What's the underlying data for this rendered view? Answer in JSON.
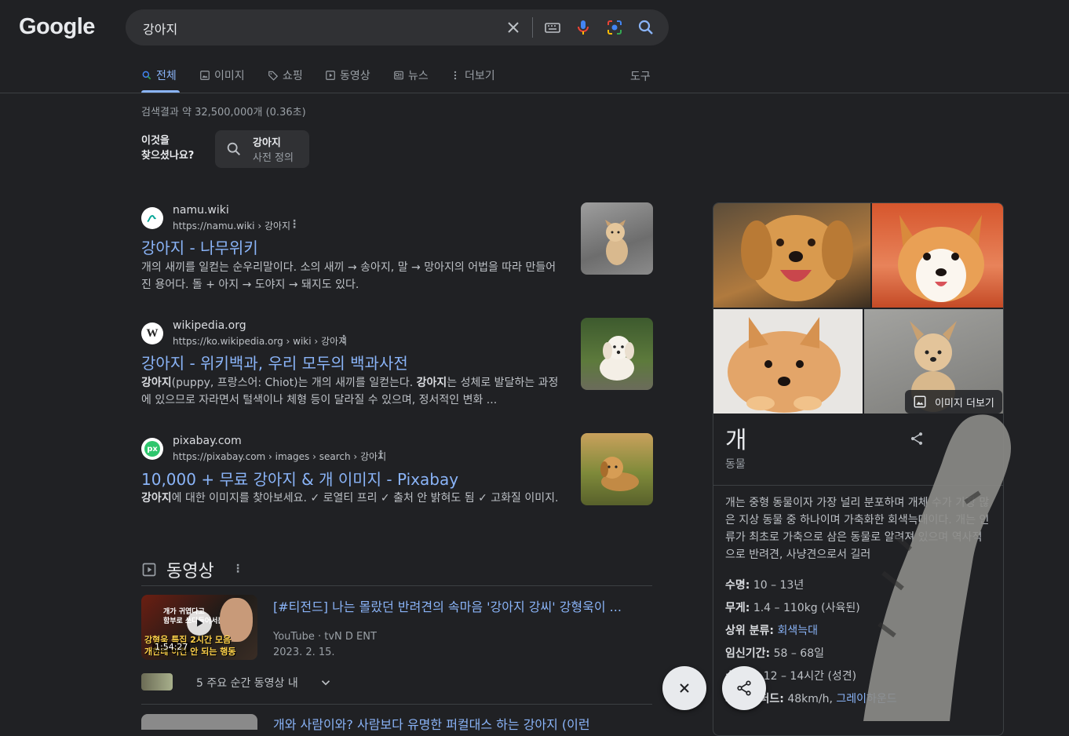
{
  "header": {
    "logo": "Google",
    "search_value": "강아지"
  },
  "tabs": [
    {
      "label": "전체",
      "icon": "search-icon",
      "active": true
    },
    {
      "label": "이미지",
      "icon": "image-icon"
    },
    {
      "label": "쇼핑",
      "icon": "tag-icon"
    },
    {
      "label": "동영상",
      "icon": "play-icon"
    },
    {
      "label": "뉴스",
      "icon": "news-icon"
    },
    {
      "label": "더보기",
      "icon": "more-vert-icon"
    }
  ],
  "tools_label": "도구",
  "result_stats": "검색결과 약 32,500,000개 (0.36초)",
  "did_you_mean": {
    "label": "이것을\n찾으셨나요?",
    "title": "강아지",
    "subtitle": "사전 정의"
  },
  "results": [
    {
      "site": "namu.wiki",
      "url": "https://namu.wiki › 강아지",
      "title": "강아지 - 나무위키",
      "snippet": "개의 새끼를 일컫는 순우리말이다. 소의 새끼 → 송아지, 말 → 망아지의 어법을 따라 만들어진 용어다. 돌 + 아지 → 도야지 → 돼지도 있다."
    },
    {
      "site": "wikipedia.org",
      "url": "https://ko.wikipedia.org › wiki › 강아지",
      "title": "강아지 - 위키백과, 우리 모두의 백과사전",
      "snippet_parts": [
        "강아지",
        "(puppy, 프랑스어: Chiot)는 개의 새끼를 일컫는다. ",
        "강아지",
        "는 성체로 발달하는 과정에 있으므로 자라면서 털색이나 체형 등이 달라질 수 있으며, 정서적인 변화 ..."
      ]
    },
    {
      "site": "pixabay.com",
      "url": "https://pixabay.com › images › search › 강아지",
      "title": "10,000 + 무료 강아지 & 개 이미지 - Pixabay",
      "snippet_parts": [
        "강아지",
        "에 대한 이미지를 찾아보세요. ✓ 로열티 프리 ✓ 출처 안 밝혀도 됨 ✓ 고화질 이미지."
      ]
    }
  ],
  "videos": {
    "heading": "동영상",
    "item": {
      "title": "[#티전드] 나는 몰랐던 반려견의 속마음 '강아지 강씨' 강형욱이 ...",
      "source": "YouTube · tvN D ENT",
      "date": "2023. 2. 15.",
      "duration": "1:54:27",
      "thumb_caption_top": "개가 귀엽다고\n함부로 쓰다듬어서는",
      "thumb_caption_bottom": "강형욱 특집 2시간 모음\n개한테 이건 안 되는 행동",
      "moments": "5 주요 순간 동영상 내"
    },
    "next_title": "개와 사람이와? 사람보다 유명한 퍼컬대스 하는 강아지 (이런"
  },
  "knowledge_panel": {
    "more_images": "이미지 더보기",
    "title": "개",
    "subtitle": "동물",
    "description": "개는 중형 동물이자 가장 널리 분포하며 개체 수가 가장 많은 지상 동물 중 하나이며 가축화한 회색늑대이다. 개는 인류가 최초로 가축으로 삼은 동물로 알려져 있으며 역사적으로 반려견, 사냥견으로서 길러",
    "facts": [
      {
        "key": "수명:",
        "value": "10 – 13년"
      },
      {
        "key": "무게:",
        "value": "1.4 – 110kg (사육된)"
      },
      {
        "key": "상위 분류:",
        "link": "회색늑대"
      },
      {
        "key": "임신기간:",
        "value": "58 – 68일"
      },
      {
        "key": "수면양:",
        "value": "12 – 14시간 (성견)"
      },
      {
        "key": "저먼 셰퍼드:",
        "value": "48km/h, ",
        "link": "그레이하운드"
      }
    ]
  },
  "colors": {
    "background": "#202124",
    "link": "#8ab4f8",
    "text": "#bdc1c6",
    "muted": "#9aa0a6"
  }
}
